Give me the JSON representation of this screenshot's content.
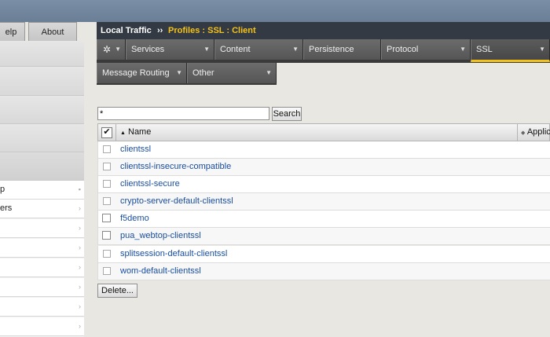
{
  "top_tabs": [
    {
      "label": "elp"
    },
    {
      "label": "About"
    }
  ],
  "left_nav": {
    "items": [
      {
        "label": "p",
        "arrow": "▪"
      },
      {
        "label": "ers",
        "arrow": "›"
      },
      {
        "label": "",
        "arrow": "›"
      },
      {
        "label": "",
        "arrow": "›"
      },
      {
        "label": "",
        "arrow": "›"
      },
      {
        "label": "",
        "arrow": "›"
      },
      {
        "label": "",
        "arrow": "›"
      },
      {
        "label": "",
        "arrow": "›"
      }
    ]
  },
  "breadcrumb": {
    "section": "Local Traffic",
    "separator": "››",
    "current": "Profiles : SSL : Client"
  },
  "tabs_row1": [
    {
      "label": "",
      "icon": "gear-icon"
    },
    {
      "label": "Services"
    },
    {
      "label": "Content"
    },
    {
      "label": "Persistence"
    },
    {
      "label": "Protocol"
    },
    {
      "label": "SSL"
    }
  ],
  "tabs_row2": [
    {
      "label": "Message Routing"
    },
    {
      "label": "Other"
    }
  ],
  "search": {
    "value": "*",
    "button_label": "Search"
  },
  "table": {
    "columns": [
      "Name",
      "Applic"
    ],
    "sort_indicator": "▲",
    "rows": [
      {
        "name": "clientssl"
      },
      {
        "name": "clientssl-insecure-compatible"
      },
      {
        "name": "clientssl-secure"
      },
      {
        "name": "crypto-server-default-clientssl"
      },
      {
        "name": "f5demo"
      },
      {
        "name": "pua_webtop-clientssl"
      },
      {
        "name": "splitsession-default-clientssl"
      },
      {
        "name": "wom-default-clientssl"
      }
    ]
  },
  "delete_label": "Delete...",
  "colors": {
    "header_bg": "#333a44",
    "accent": "#f3c21a",
    "link": "#1a4ea0"
  }
}
